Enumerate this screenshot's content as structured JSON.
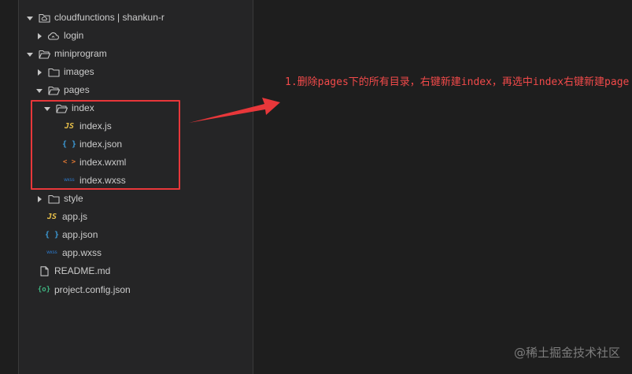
{
  "explorer": {
    "items": [
      {
        "label": "cloudfunctions | shankun-r",
        "icon": "cloud-folder-icon",
        "expanded": true
      },
      {
        "label": "login",
        "icon": "cloud-function-icon",
        "expanded": false
      },
      {
        "label": "miniprogram",
        "icon": "folder-open-icon",
        "expanded": true
      },
      {
        "label": "images",
        "icon": "folder-icon",
        "expanded": false
      },
      {
        "label": "pages",
        "icon": "folder-open-icon",
        "expanded": true
      },
      {
        "label": "index",
        "icon": "folder-open-icon",
        "expanded": true
      },
      {
        "label": "index.js",
        "icon": "js-file-icon",
        "badge": "JS"
      },
      {
        "label": "index.json",
        "icon": "json-file-icon",
        "badge": "{ }"
      },
      {
        "label": "index.wxml",
        "icon": "wxml-file-icon",
        "badge": "< >"
      },
      {
        "label": "index.wxss",
        "icon": "wxss-file-icon",
        "badge": "wxss"
      },
      {
        "label": "style",
        "icon": "folder-icon",
        "expanded": false
      },
      {
        "label": "app.js",
        "icon": "js-file-icon",
        "badge": "JS"
      },
      {
        "label": "app.json",
        "icon": "json-file-icon",
        "badge": "{ }"
      },
      {
        "label": "app.wxss",
        "icon": "wxss-file-icon",
        "badge": "wxss"
      },
      {
        "label": "README.md",
        "icon": "file-icon"
      },
      {
        "label": "project.config.json",
        "icon": "config-file-icon",
        "badge": "{o}"
      }
    ]
  },
  "annotation": {
    "text": "1.删除pages下的所有目录，右键新建index，再选中index右键新建page",
    "color": "#f24a4a"
  },
  "highlight": {
    "color": "#e8373a"
  },
  "watermark": {
    "text": "@稀土掘金技术社区"
  }
}
